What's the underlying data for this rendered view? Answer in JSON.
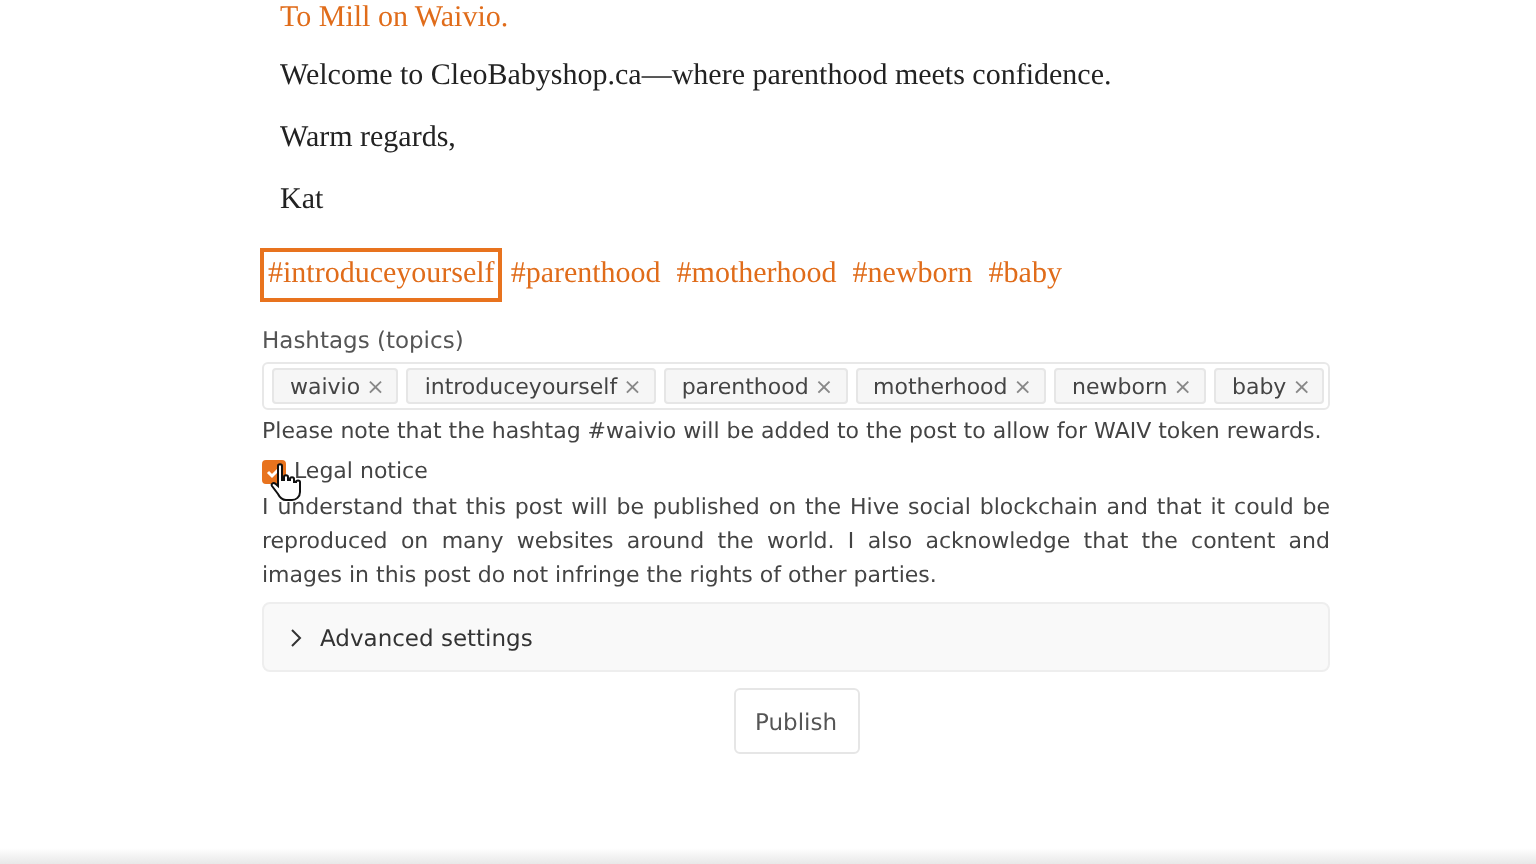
{
  "post": {
    "link_line": "To Mill on Waivio.",
    "paragraphs": [
      "Welcome to CleoBabyshop.ca—where parenthood meets confidence.",
      "Warm regards,",
      "Kat"
    ],
    "hashtags": [
      {
        "text": "#introduceyourself",
        "highlighted": true
      },
      {
        "text": "#parenthood",
        "highlighted": false
      },
      {
        "text": "#motherhood",
        "highlighted": false
      },
      {
        "text": "#newborn",
        "highlighted": false
      },
      {
        "text": "#baby",
        "highlighted": false
      }
    ]
  },
  "hashtags_field": {
    "label": "Hashtags (topics)",
    "tags": [
      {
        "text": "waivio",
        "remove": "×"
      },
      {
        "text": "introduceyourself",
        "remove": "×"
      },
      {
        "text": "parenthood",
        "remove": "×"
      },
      {
        "text": "motherhood",
        "remove": "×"
      },
      {
        "text": "newborn",
        "remove": "×"
      },
      {
        "text": "baby",
        "remove": "×"
      }
    ],
    "note": "Please note that the hashtag #waivio will be added to the post to allow for WAIV token rewards."
  },
  "legal": {
    "label": "Legal notice",
    "checked": true,
    "text": "I understand that this post will be published on the Hive social blockchain and that it could be reproduced on many websites around the world. I also acknowledge that the content and images in this post do not infringe the rights of other parties."
  },
  "advanced": {
    "label": "Advanced settings",
    "expanded": false
  },
  "publish_button": "Publish"
}
